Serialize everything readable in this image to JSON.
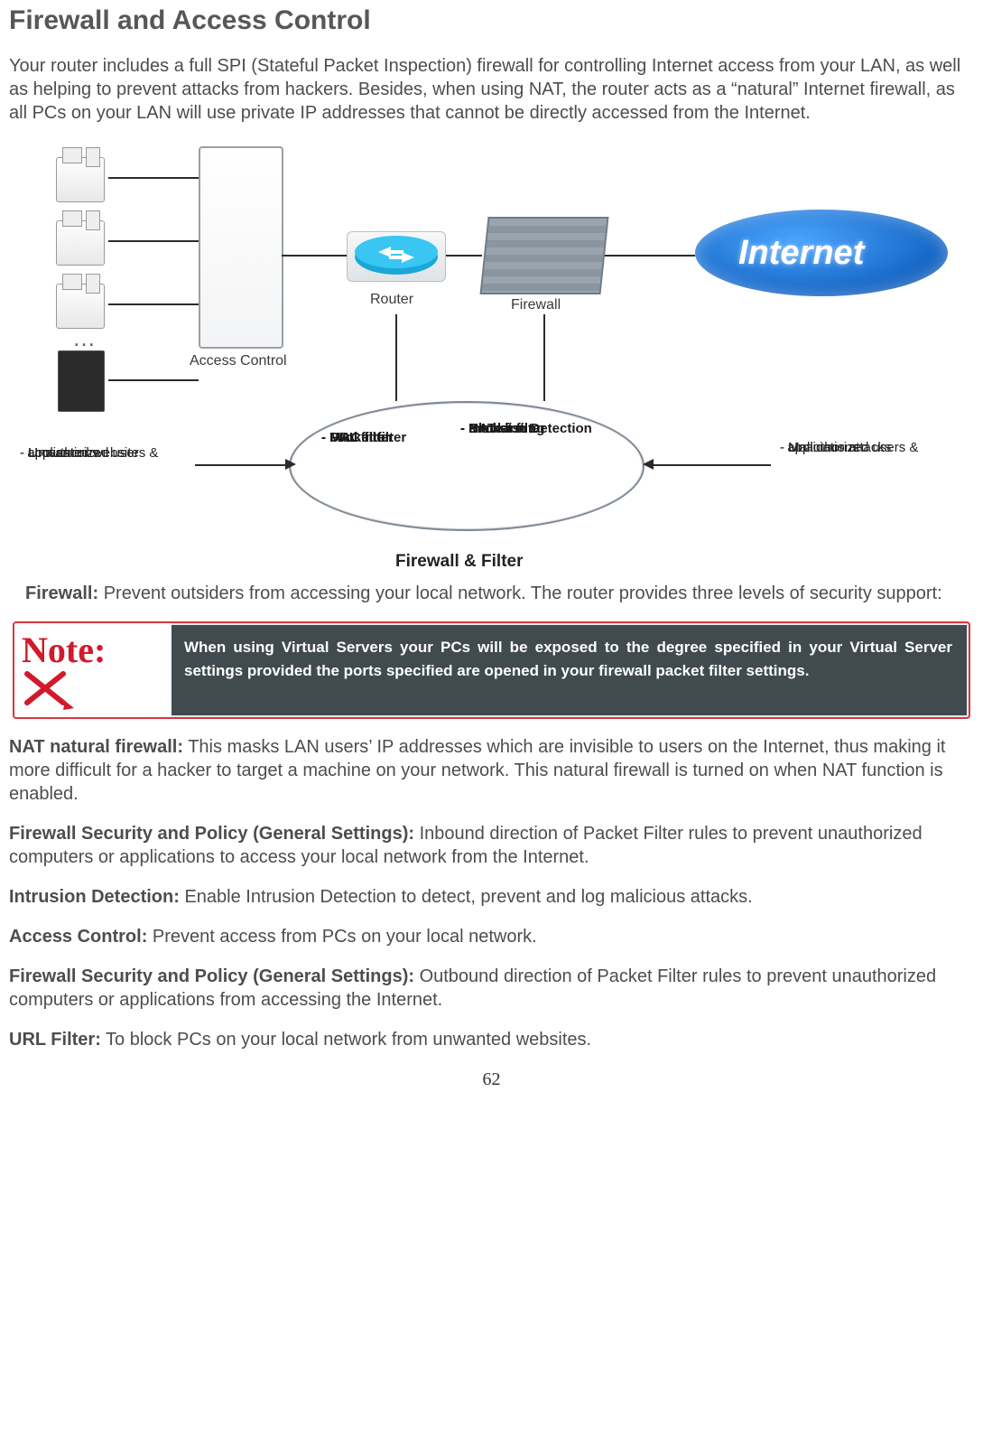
{
  "title": "Firewall and Access Control",
  "intro": "Your router includes a full SPI (Stateful Packet Inspection) firewall for controlling Internet access from your LAN, as well as helping to prevent attacks from hackers. Besides, when using NAT, the router acts as a “natural” Internet firewall, as all PCs on your LAN will use private IP addresses that cannot be directly accessed from the Internet.",
  "diagram": {
    "access_control": "Access Control",
    "router": "Router",
    "firewall": "Firewall",
    "internet": "Internet",
    "ellipse_left": [
      "- Packet filter",
      "- MAC filter",
      "- URL filter"
    ],
    "ellipse_right": [
      "- NAT",
      "- Packet filter",
      "- Intrusion Detection",
      "- Blacklisting"
    ],
    "threat_left": [
      "- Unauthorized users &",
      "  applications",
      "- Unwanted website",
      "  access"
    ],
    "threat_right": [
      "- Unauthorized users &",
      "  applications",
      "- Malicious attacks"
    ],
    "caption": "Firewall & Filter",
    "dots": "…"
  },
  "firewall_line_bold": "Firewall:",
  "firewall_line_text": " Prevent outsiders from accessing your local network. The router provides three levels of security support:",
  "note": {
    "label": "Note:",
    "text": "When using Virtual Servers your PCs will be exposed to the degree specified in your Virtual Server settings provided the ports specified are opened in your firewall packet filter settings."
  },
  "items": [
    {
      "bold": "NAT natural firewall:",
      "text": " This masks LAN users’ IP addresses which are invisible to users on the Internet, thus making it more difficult for a hacker to target a machine on your network. This natural firewall is turned on when NAT function is enabled."
    },
    {
      "bold": "Firewall Security and Policy (General Settings):",
      "text": " Inbound direction of Packet Filter rules to prevent unauthorized computers or applications to access your local network from the Internet."
    },
    {
      "bold": "Intrusion Detection:",
      "text": " Enable Intrusion Detection to detect, prevent and log malicious attacks."
    },
    {
      "bold": "Access Control:",
      "text": " Prevent access from PCs on your local network."
    },
    {
      "bold": "Firewall Security and Policy (General Settings):",
      "text": " Outbound direction of Packet Filter rules to prevent unauthorized computers or applications from accessing the Internet."
    },
    {
      "bold": "URL Filter:",
      "text": " To block PCs on your local network from unwanted websites."
    }
  ],
  "page_number": "62"
}
